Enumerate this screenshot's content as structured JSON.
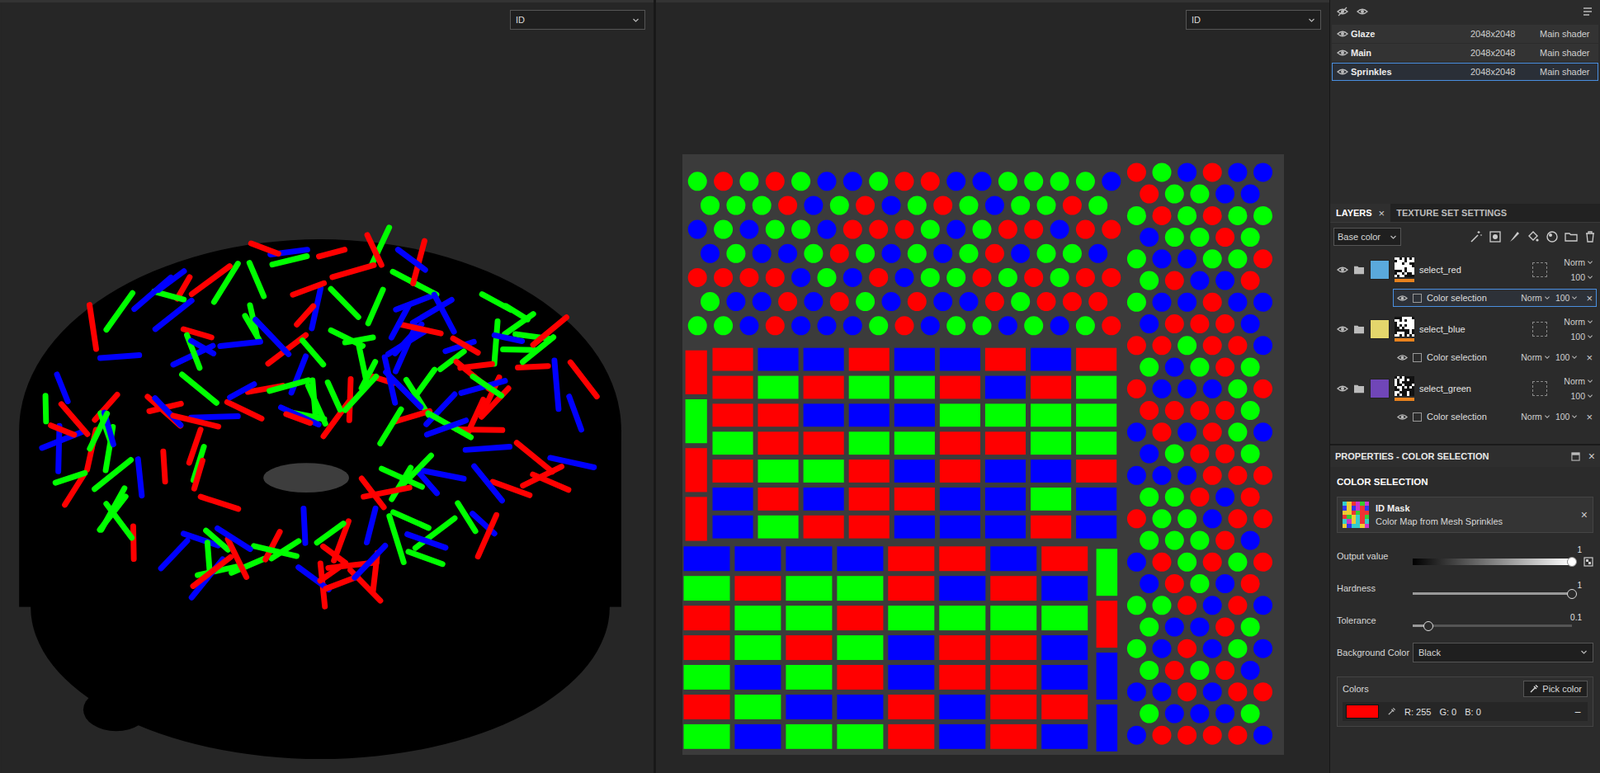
{
  "viewports": [
    {
      "mode": "ID"
    },
    {
      "mode": "ID"
    }
  ],
  "texture_sets": [
    {
      "name": "Glaze",
      "resolution": "2048x2048",
      "shader": "Main shader",
      "visible": true,
      "selected": false
    },
    {
      "name": "Main",
      "resolution": "2048x2048",
      "shader": "Main shader",
      "visible": true,
      "selected": false
    },
    {
      "name": "Sprinkles",
      "resolution": "2048x2048",
      "shader": "Main shader",
      "visible": true,
      "selected": true
    }
  ],
  "tabs": [
    {
      "label": "LAYERS",
      "close": "×",
      "selected": true
    },
    {
      "label": "TEXTURE SET SETTINGS",
      "close": "",
      "selected": false
    }
  ],
  "channel": "Base color",
  "layers": [
    {
      "name": "select_red",
      "color": "#5aa9dc",
      "visible": true,
      "blend": "Norm",
      "opacity": "100",
      "effect": {
        "name": "Color selection",
        "visible": true,
        "enabled": false,
        "blend": "Norm",
        "opacity": "100",
        "close": "×",
        "selected": true
      }
    },
    {
      "name": "select_blue",
      "color": "#e4d66c",
      "visible": true,
      "blend": "Norm",
      "opacity": "100",
      "effect": {
        "name": "Color selection",
        "visible": true,
        "enabled": false,
        "blend": "Norm",
        "opacity": "100",
        "close": "×",
        "selected": false
      }
    },
    {
      "name": "select_green",
      "color": "#7046b8",
      "visible": true,
      "blend": "Norm",
      "opacity": "100",
      "effect": {
        "name": "Color selection",
        "visible": true,
        "enabled": false,
        "blend": "Norm",
        "opacity": "100",
        "close": "×",
        "selected": false
      }
    }
  ],
  "properties": {
    "title": "PROPERTIES - COLOR SELECTION",
    "close": "×",
    "section": "COLOR SELECTION",
    "mask": {
      "title": "ID Mask",
      "subtitle": "Color Map from Mesh Sprinkles",
      "close": "×"
    },
    "params": [
      {
        "kind": "gradient",
        "label": "Output value",
        "value": "1",
        "level": 1
      },
      {
        "kind": "slider",
        "label": "Hardness",
        "value": "1",
        "level": 1
      },
      {
        "kind": "slider",
        "label": "Tolerance",
        "value": "0.1",
        "level": 0.1
      },
      {
        "kind": "dropdown",
        "label": "Background Color",
        "value": "Black"
      }
    ],
    "colors": {
      "label": "Colors",
      "pick": "Pick color",
      "items": [
        {
          "color": "#ff0000",
          "r": "R: 255",
          "g": "G: 0",
          "b": "B: 0",
          "remove": "−"
        }
      ]
    }
  }
}
